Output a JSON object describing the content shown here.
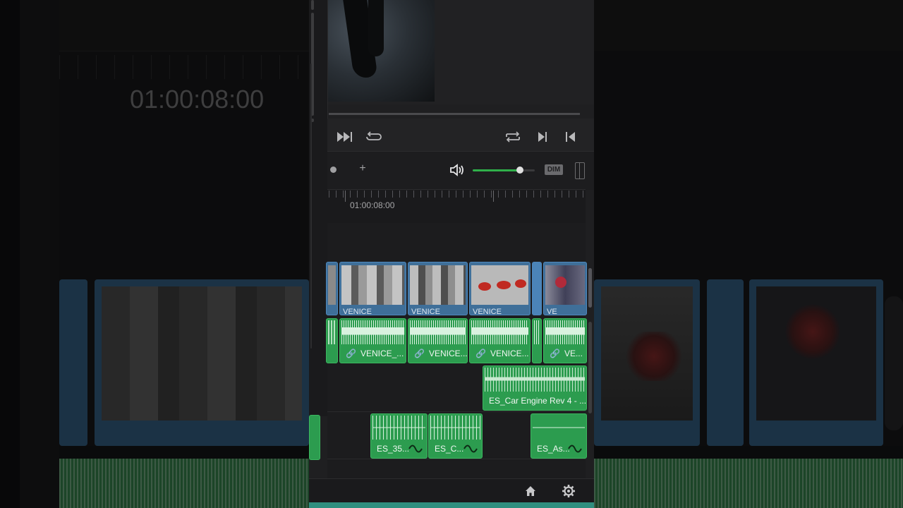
{
  "app": {
    "viewer_timecode_bg": "01:00:08:00"
  },
  "toolbar": {
    "dim_label": "DIM",
    "plus_label": "+"
  },
  "timeline": {
    "ruler_timecode": "01:00:08:00",
    "video_clips": [
      {
        "label": "VENICE_"
      },
      {
        "label": "VENICE_"
      },
      {
        "label": "VENICE_"
      },
      {
        "label": "VE"
      }
    ],
    "audio_track1": [
      {
        "label": "VENICE_..."
      },
      {
        "label": "VENICE..."
      },
      {
        "label": "VENICE..."
      },
      {
        "label": "VE..."
      }
    ],
    "audio_track2": [
      {
        "label": "ES_Car Engine Rev 4 - ..."
      }
    ],
    "audio_track3": [
      {
        "label": "ES_35..."
      },
      {
        "label": "ES_C..."
      },
      {
        "label": "ES_As..."
      }
    ]
  },
  "colors": {
    "video_clip": "#3f6f99",
    "audio_clip": "#2c9c4f",
    "volume_fill": "#2fb04a"
  },
  "icons": [
    "fast-forward-icon",
    "loop-icon",
    "repeat-icon",
    "next-frame-icon",
    "prev-frame-icon",
    "volume-icon",
    "home-icon",
    "gear-icon",
    "link-icon",
    "fade-curve-icon"
  ]
}
